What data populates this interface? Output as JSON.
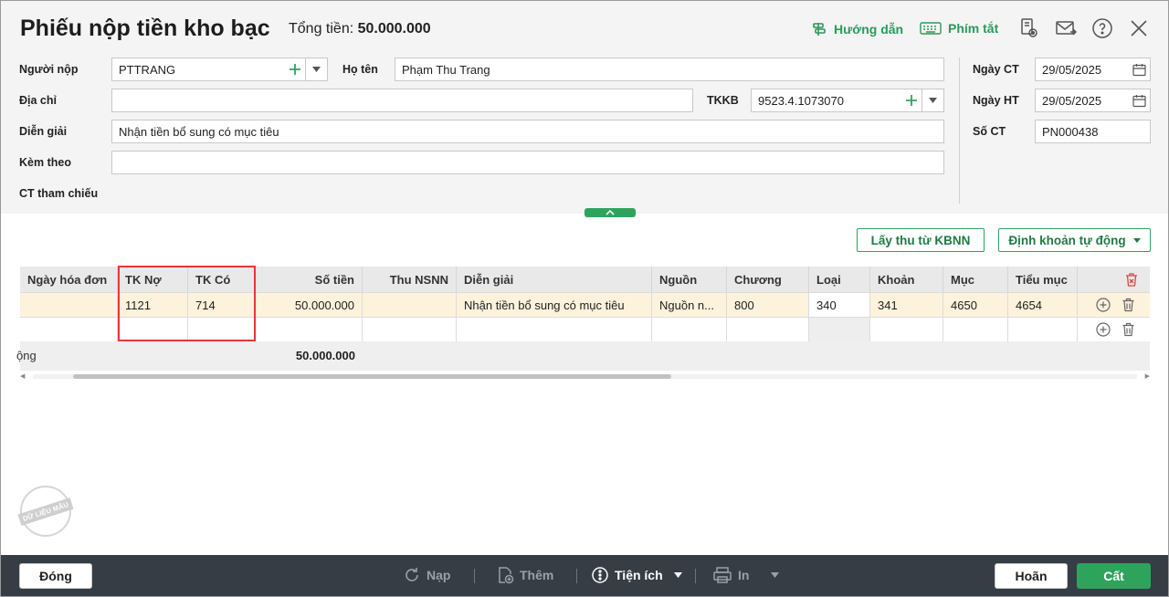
{
  "header": {
    "title": "Phiếu nộp tiền kho bạc",
    "total_label": "Tổng tiền:",
    "total_value": "50.000.000",
    "guide_label": "Hướng dẫn",
    "shortcut_label": "Phím tắt"
  },
  "form": {
    "payer_label": "Người nộp",
    "payer_value": "PTTRANG",
    "fullname_label": "Họ tên",
    "fullname_value": "Phạm Thu Trang",
    "address_label": "Địa chỉ",
    "address_value": "",
    "tkkb_label": "TKKB",
    "tkkb_value": "9523.4.1073070",
    "description_label": "Diễn giải",
    "description_value": "Nhận tiền bổ sung có mục tiêu",
    "attach_label": "Kèm theo",
    "attach_value": "",
    "reference_label": "CT tham chiếu",
    "doc_date_label": "Ngày CT",
    "doc_date_value": "29/05/2025",
    "post_date_label": "Ngày HT",
    "post_date_value": "29/05/2025",
    "doc_no_label": "Số CT",
    "doc_no_value": "PN000438"
  },
  "actions": {
    "fetch_label": "Lấy thu từ KBNN",
    "auto_label": "Định khoản tự động"
  },
  "grid": {
    "columns": [
      "Ngày hóa đơn",
      "TK Nợ",
      "TK Có",
      "Số tiền",
      "Thu NSNN",
      "Diễn giải",
      "Nguồn",
      "Chương",
      "Loại",
      "Khoản",
      "Mục",
      "Tiểu mục"
    ],
    "rows": [
      [
        "",
        "1121",
        "714",
        "50.000.000",
        "",
        "Nhận tiền bổ sung có mục tiêu",
        "Nguồn n...",
        "800",
        "340",
        "341",
        "4650",
        "4654"
      ],
      [
        "",
        "",
        "",
        "",
        "",
        "",
        "",
        "",
        "",
        "",
        "",
        ""
      ]
    ],
    "total_label": "Tổng",
    "total_label_visible": "ộng",
    "total_value": "50.000.000"
  },
  "watermark": "DỮ LIỆU MẪU",
  "footer": {
    "close_label": "Đóng",
    "reload_label": "Nạp",
    "add_label": "Thêm",
    "utility_label": "Tiện ích",
    "print_label": "In",
    "cancel_label": "Hoãn",
    "save_label": "Cất"
  },
  "colors": {
    "accent": "#2ea35c",
    "footer_bg": "#363d45",
    "row_selected": "#fdf2dc",
    "highlight": "#e53935"
  }
}
